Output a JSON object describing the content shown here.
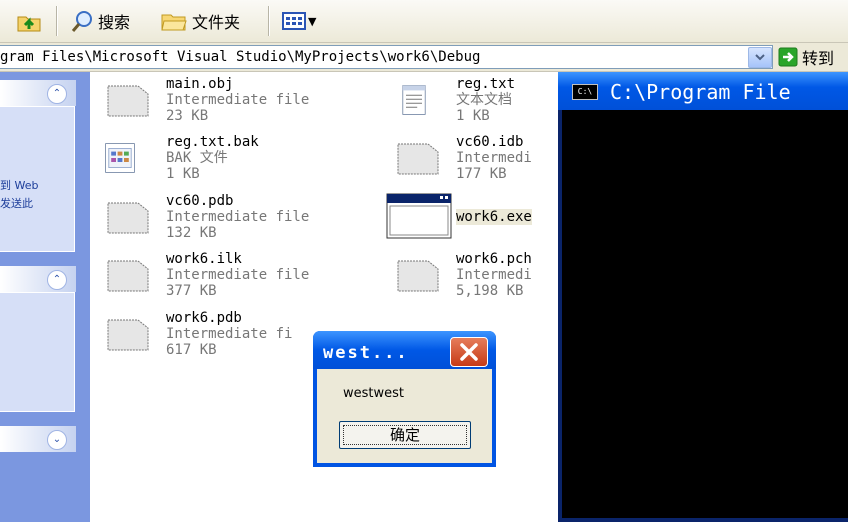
{
  "toolbar": {
    "search_label": "搜索",
    "folders_label": "文件夹"
  },
  "address": {
    "path": "gram Files\\Microsoft Visual Studio\\MyProjects\\work6\\Debug",
    "go_label": "转到"
  },
  "taskpane": {
    "text_line1": "到 Web",
    "text_line2": "发送此"
  },
  "files": [
    {
      "name": "main.obj",
      "type": "Intermediate file",
      "size": "23 KB",
      "icon": "generic-file-icon"
    },
    {
      "name": "reg.txt",
      "type": "文本文档",
      "size": "1 KB",
      "icon": "text-document-icon"
    },
    {
      "name": "reg.txt.bak",
      "type": "BAK 文件",
      "size": "1 KB",
      "icon": "bak-file-icon"
    },
    {
      "name": "vc60.idb",
      "type": "Intermedi",
      "size": "177 KB",
      "icon": "generic-file-icon"
    },
    {
      "name": "vc60.pdb",
      "type": "Intermediate file",
      "size": "132 KB",
      "icon": "generic-file-icon"
    },
    {
      "name": "work6.exe",
      "type": "",
      "size": "",
      "icon": "exe-window-icon"
    },
    {
      "name": "work6.ilk",
      "type": "Intermediate file",
      "size": "377 KB",
      "icon": "generic-file-icon"
    },
    {
      "name": "work6.pch",
      "type": "Intermedi",
      "size": "5,198 KB",
      "icon": "generic-file-icon"
    },
    {
      "name": "work6.pdb",
      "type": "Intermediate fi",
      "size": "617 KB",
      "icon": "generic-file-icon"
    }
  ],
  "console": {
    "title": "C:\\Program File",
    "icon_text": "C:\\"
  },
  "msgbox": {
    "title": "west...",
    "message": "westwest",
    "ok_label": "确定"
  }
}
